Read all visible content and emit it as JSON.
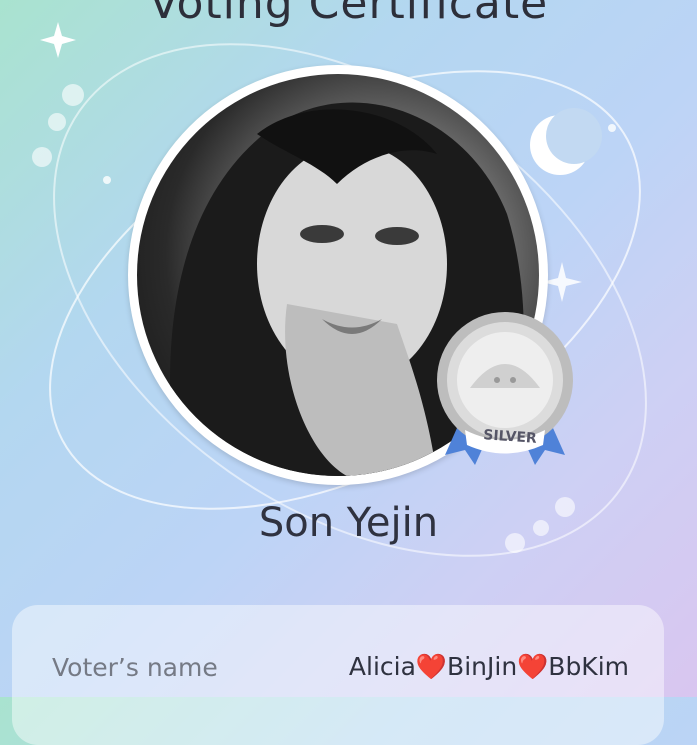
{
  "title": "Voting Certificate",
  "celebrity": {
    "name": "Son Yejin",
    "portrait_icon": "portrait-photo"
  },
  "badge": {
    "label": "SILVER",
    "icon": "silver-medal-icon",
    "colors": {
      "medal": "#c9c9c9",
      "ribbon": "#4f82d8"
    }
  },
  "voter": {
    "label": "Voter’s name",
    "value": "Alicia❤️BinJin❤️BbKim"
  },
  "colors": {
    "text_dark": "#2d2f3a",
    "text_muted": "#757a85"
  }
}
